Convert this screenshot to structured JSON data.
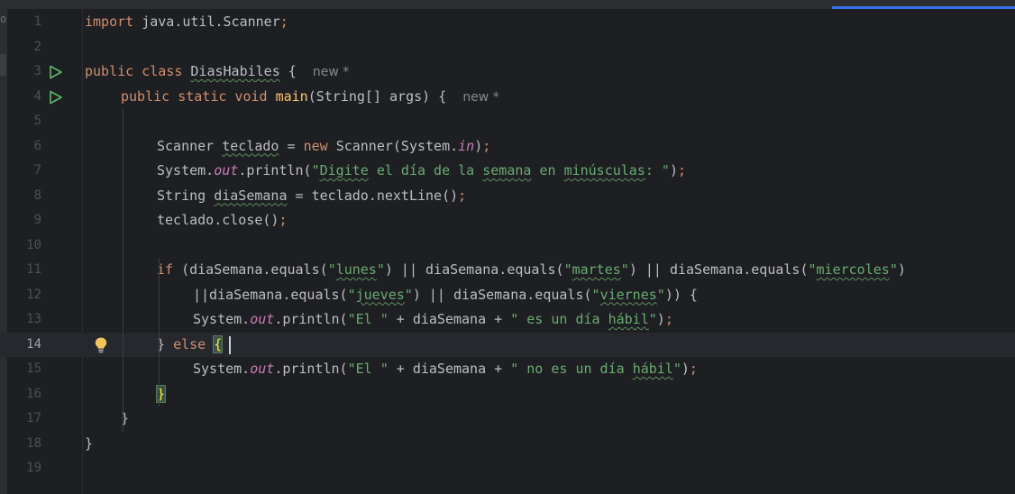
{
  "editor": {
    "left_edge_char": "o",
    "current_line": 14,
    "lines": [
      {
        "n": "1",
        "html_parts": [
          [
            "kw",
            "import "
          ],
          [
            "",
            "java.util.Scanner"
          ],
          [
            "kw",
            ";"
          ]
        ]
      },
      {
        "n": "2",
        "html_parts": []
      },
      {
        "n": "3",
        "run": true,
        "html_parts": [
          [
            "kw",
            "public class "
          ],
          [
            "typo",
            "DiasHabiles"
          ],
          [
            "",
            " {  "
          ],
          [
            "hint",
            "new *"
          ]
        ]
      },
      {
        "n": "4",
        "run": true,
        "html_parts": [
          [
            "",
            " "
          ],
          [
            "kw",
            "public static void "
          ],
          [
            "mth",
            "main"
          ],
          [
            "",
            "(String[] args) {  "
          ],
          [
            "hint",
            "new *"
          ]
        ]
      },
      {
        "n": "5",
        "html_parts": []
      },
      {
        "n": "6",
        "html_parts": [
          [
            "",
            "Scanner "
          ],
          [
            "typo",
            "teclado"
          ],
          [
            "",
            " = "
          ],
          [
            "kw",
            "new "
          ],
          [
            "",
            "Scanner(System."
          ],
          [
            "fld",
            "in"
          ],
          [
            "",
            ")"
          ],
          [
            "kw",
            ";"
          ]
        ]
      },
      {
        "n": "7",
        "html_parts": [
          [
            "",
            "System."
          ],
          [
            "fld",
            "out"
          ],
          [
            "",
            ".println("
          ],
          [
            "str",
            "\""
          ],
          [
            "str typo",
            "Digite"
          ],
          [
            "str",
            " el día de la "
          ],
          [
            "str typo",
            "semana"
          ],
          [
            "str",
            " en "
          ],
          [
            "str typo",
            "minúsculas"
          ],
          [
            "str",
            ": \""
          ],
          [
            "",
            ")"
          ],
          [
            "kw",
            ";"
          ]
        ]
      },
      {
        "n": "8",
        "html_parts": [
          [
            "",
            "String "
          ],
          [
            "typo",
            "diaSemana"
          ],
          [
            "",
            " = teclado.nextLine()"
          ],
          [
            "kw",
            ";"
          ]
        ]
      },
      {
        "n": "9",
        "html_parts": [
          [
            "",
            "teclado.close()"
          ],
          [
            "kw",
            ";"
          ]
        ]
      },
      {
        "n": "10",
        "html_parts": []
      },
      {
        "n": "11",
        "html_parts": [
          [
            "kw",
            "if "
          ],
          [
            "",
            "(diaSemana.equals("
          ],
          [
            "str",
            "\""
          ],
          [
            "str typo",
            "lunes"
          ],
          [
            "str",
            "\""
          ],
          [
            "",
            ") || diaSemana.equals("
          ],
          [
            "str",
            "\""
          ],
          [
            "str typo",
            "martes"
          ],
          [
            "str",
            "\""
          ],
          [
            "",
            ") || diaSemana.equals("
          ],
          [
            "str",
            "\""
          ],
          [
            "str typo",
            "miercoles"
          ],
          [
            "str",
            "\""
          ],
          [
            "",
            ")"
          ]
        ]
      },
      {
        "n": "12",
        "html_parts": [
          [
            "",
            "||diaSemana.equals("
          ],
          [
            "str",
            "\""
          ],
          [
            "str typo",
            "jueves"
          ],
          [
            "str",
            "\""
          ],
          [
            "",
            ") || diaSemana.equals("
          ],
          [
            "str",
            "\""
          ],
          [
            "str typo",
            "viernes"
          ],
          [
            "str",
            "\""
          ],
          [
            "",
            ")) {"
          ]
        ]
      },
      {
        "n": "13",
        "html_parts": [
          [
            "",
            "System."
          ],
          [
            "fld",
            "out"
          ],
          [
            "",
            ".println("
          ],
          [
            "str",
            "\"El \""
          ],
          [
            "",
            " + diaSemana + "
          ],
          [
            "str",
            "\" es un día "
          ],
          [
            "str typo",
            "hábil"
          ],
          [
            "str",
            "\""
          ],
          [
            "",
            ")"
          ],
          [
            "kw",
            ";"
          ]
        ]
      },
      {
        "n": "14",
        "bulb": true,
        "html_parts": [
          [
            "",
            "} "
          ],
          [
            "kw",
            "else "
          ],
          [
            "brace-match",
            "{"
          ]
        ]
      },
      {
        "n": "15",
        "html_parts": [
          [
            "",
            "System."
          ],
          [
            "fld",
            "out"
          ],
          [
            "",
            ".println("
          ],
          [
            "str",
            "\"El \""
          ],
          [
            "",
            " + diaSemana + "
          ],
          [
            "str",
            "\" no es un día "
          ],
          [
            "str typo",
            "hábil"
          ],
          [
            "str",
            "\""
          ],
          [
            "",
            ")"
          ],
          [
            "kw",
            ";"
          ]
        ]
      },
      {
        "n": "16",
        "html_parts": [
          [
            "brace-match",
            "}"
          ]
        ]
      },
      {
        "n": "17",
        "html_parts": [
          [
            "",
            "}"
          ]
        ]
      },
      {
        "n": "18",
        "html_parts": [
          [
            "",
            "}"
          ]
        ]
      },
      {
        "n": "19",
        "html_parts": []
      }
    ]
  }
}
